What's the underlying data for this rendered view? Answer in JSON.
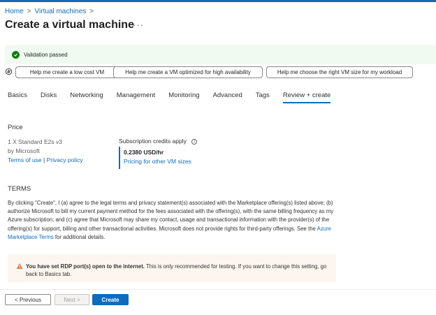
{
  "breadcrumb": [
    "Home",
    "Virtual machines"
  ],
  "breadcrumb_separator": ">",
  "page_title": "Create a virtual machine",
  "more_label": "···",
  "validation": {
    "text": "Validation passed",
    "color": "#107c10"
  },
  "assist_chips": [
    "Help me create a low cost VM",
    "Help me create a VM optimized for high availability",
    "Help me choose the right VM size for my workload"
  ],
  "tabs": [
    "Basics",
    "Disks",
    "Networking",
    "Management",
    "Monitoring",
    "Advanced",
    "Tags",
    "Review + create"
  ],
  "active_tab": "Review + create",
  "price": {
    "heading": "Price",
    "product": "1 X Standard E2s v3",
    "publisher": "by Microsoft",
    "terms_link": "Terms of use",
    "divider": "|",
    "privacy_link": "Privacy policy",
    "credits_label": "Subscription credits apply",
    "amount": "0.2380 USD/hr",
    "other_sizes_link": "Pricing for other VM sizes"
  },
  "terms": {
    "heading": "TERMS",
    "body_before": "By clicking \"Create\", I (a) agree to the legal terms and privacy statement(s) associated with the Marketplace offering(s) listed above; (b) authorize Microsoft to bill my current payment method for the fees associated with the offering(s), with the same billing frequency as my Azure subscription; and (c) agree that Microsoft may share my contact, usage and transactional information with the provider(s) of the offering(s) for support, billing and other transactional activities. Microsoft does not provide rights for third-party offerings. See the ",
    "link": "Azure Marketplace Terms",
    "body_after": " for additional details."
  },
  "warning": {
    "bold": "You have set RDP port(s) open to the internet.",
    "text": " This is only recommended for testing.  If you want to change this setting, go back to Basics tab.",
    "color": "#d67f3c"
  },
  "buttons": {
    "previous": "< Previous",
    "next": "Next >",
    "create": "Create"
  },
  "accent_color": "#0f6cbd"
}
